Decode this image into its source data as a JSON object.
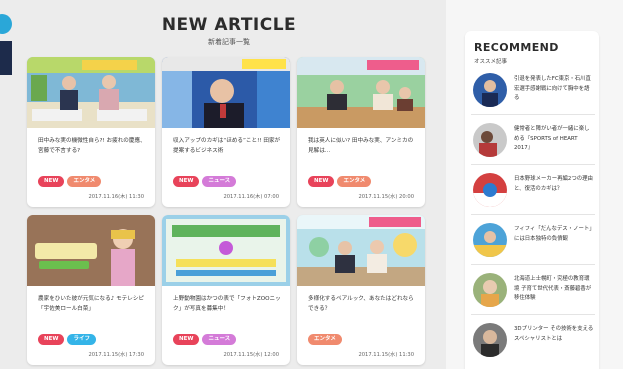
{
  "main": {
    "title": "NEW ARTICLE",
    "subtitle": "新着記事一覧",
    "articles": [
      {
        "title": "田中みな実の機微性自ら?! お疲れの慶應、宮藤で不言する?",
        "tags": [
          "NEW",
          "エンタメ"
        ],
        "date": "2017.11.16(木) 11:30"
      },
      {
        "title": "収入アップのカギは“ほめる”こと!! 田家が提案するビジネス術",
        "tags": [
          "NEW",
          "ニュース"
        ],
        "date": "2017.11.16(木) 07:00"
      },
      {
        "title": "我は英人に似い? 田中みな実、アンミカの見解は…",
        "tags": [
          "NEW",
          "エンタメ"
        ],
        "date": "2017.11.15(水) 20:00"
      },
      {
        "title": "農家をひいた彼が元気になる♪ モテレシピ「宇佐美ロール白菜」",
        "tags": [
          "NEW",
          "ライフ"
        ],
        "date": "2017.11.15(水) 17:30"
      },
      {
        "title": "上野動物園はかつの表で「フォトZOOニック」が写真を募集中！",
        "tags": [
          "NEW",
          "ニュース"
        ],
        "date": "2017.11.15(水) 12:00"
      },
      {
        "title": "多様化するペアルック、あなたはどれならできる？",
        "tags": [
          "エンタメ"
        ],
        "date": "2017.11.15(水) 11:30"
      }
    ]
  },
  "recommend": {
    "title": "RECOMMEND",
    "subtitle": "オススメ記事",
    "items": [
      {
        "text": "引退を発表したFC東京・石川直宏選手感謝戦に向けて胸中を語る"
      },
      {
        "text": "健常者と障がい者が一緒に楽しめる『SPORTS of HEART 2017』"
      },
      {
        "text": "日本野球メーカー再編2つの理由と、復活のカギは？"
      },
      {
        "text": "フィフィ「だんなデス・ノート」には日本独特の負債観"
      },
      {
        "text": "北海道上士幌町・究極の教育環境 子育て世代代表・斎藤碧香が移住体験"
      },
      {
        "text": "3Dプリンター その技術を支えるスペシャリストとは"
      }
    ]
  },
  "colors": {
    "tag_new": "#e8435a",
    "tag_entame": "#f08a6e",
    "tag_news": "#d47bd8",
    "tag_life": "#34b4e8"
  }
}
